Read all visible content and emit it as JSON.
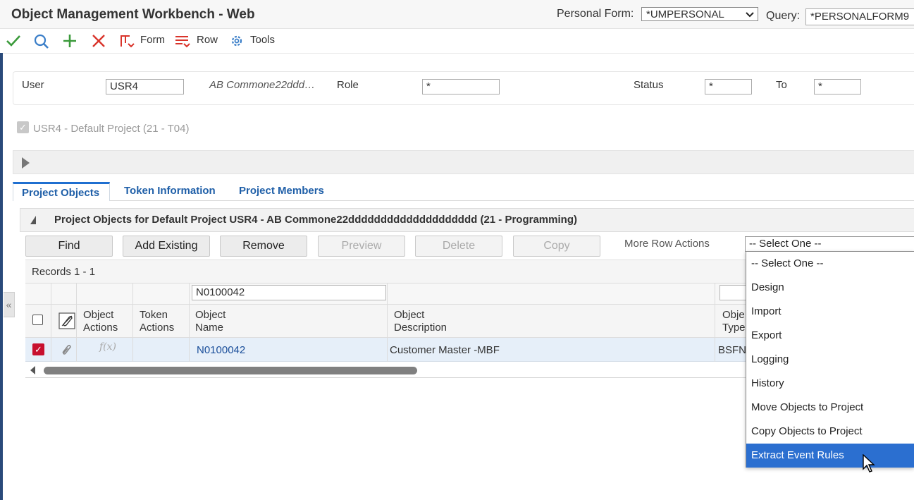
{
  "window": {
    "title": "Object Management Workbench - Web",
    "personal_form_label": "Personal Form:",
    "personal_form_value": "*UMPERSONAL",
    "query_label": "Query:",
    "query_value": "*PERSONALFORM9"
  },
  "toolbar": {
    "form_label": "Form",
    "row_label": "Row",
    "tools_label": "Tools"
  },
  "filter": {
    "user_label": "User",
    "user_value": "USR4",
    "user_desc": "AB Commone22ddd…",
    "role_label": "Role",
    "role_value": "*",
    "status_label": "Status",
    "status_value": "*",
    "to_label": "To",
    "to_value": "*"
  },
  "project": {
    "label": "USR4 - Default Project (21 - T04)"
  },
  "tabs": [
    {
      "label": "Project Objects"
    },
    {
      "label": "Token Information"
    },
    {
      "label": "Project Members"
    }
  ],
  "grid": {
    "title": "Project Objects for Default Project USR4 - AB Commone22dddddddddddddddddddd  (21 - Programming)",
    "records": "Records 1 - 1",
    "qbe_object_name": "N0100042",
    "columns": {
      "object_actions": [
        "Object",
        "Actions"
      ],
      "token_actions": [
        "Token",
        "Actions"
      ],
      "object_name": [
        "Object",
        "Name"
      ],
      "object_description": [
        "Object",
        "Description"
      ],
      "object_type": [
        "Obje",
        "Type"
      ]
    },
    "rows": [
      {
        "object_name": "N0100042",
        "object_description": "Customer Master -MBF",
        "object_type": "BSFN",
        "formula_glyph": "f(x)"
      }
    ]
  },
  "buttons": {
    "find": "Find",
    "add_existing": "Add Existing",
    "remove": "Remove",
    "preview": "Preview",
    "delete": "Delete",
    "copy": "Copy",
    "more_row_actions": "More Row Actions"
  },
  "select": {
    "current": "-- Select One --",
    "options": [
      "-- Select One --",
      "Design",
      "Import",
      "Export",
      "Logging",
      "History",
      "Move Objects to Project",
      "Copy Objects to Project",
      "Extract Event Rules"
    ],
    "highlighted_index": 8
  },
  "colors": {
    "accent": "#1f5fa8",
    "highlight": "#2b6fd0",
    "checkbox_checked": "#c8102e",
    "ok_green": "#3a9a3a",
    "cancel_red": "#d9342b",
    "icon_blue": "#3a7ec8"
  },
  "icons": {
    "ok": "checkmark-icon",
    "find": "search-icon",
    "add": "plus-icon",
    "cancel": "close-icon",
    "form": "form-menu-icon",
    "row": "row-menu-icon",
    "tools": "gear-icon"
  }
}
